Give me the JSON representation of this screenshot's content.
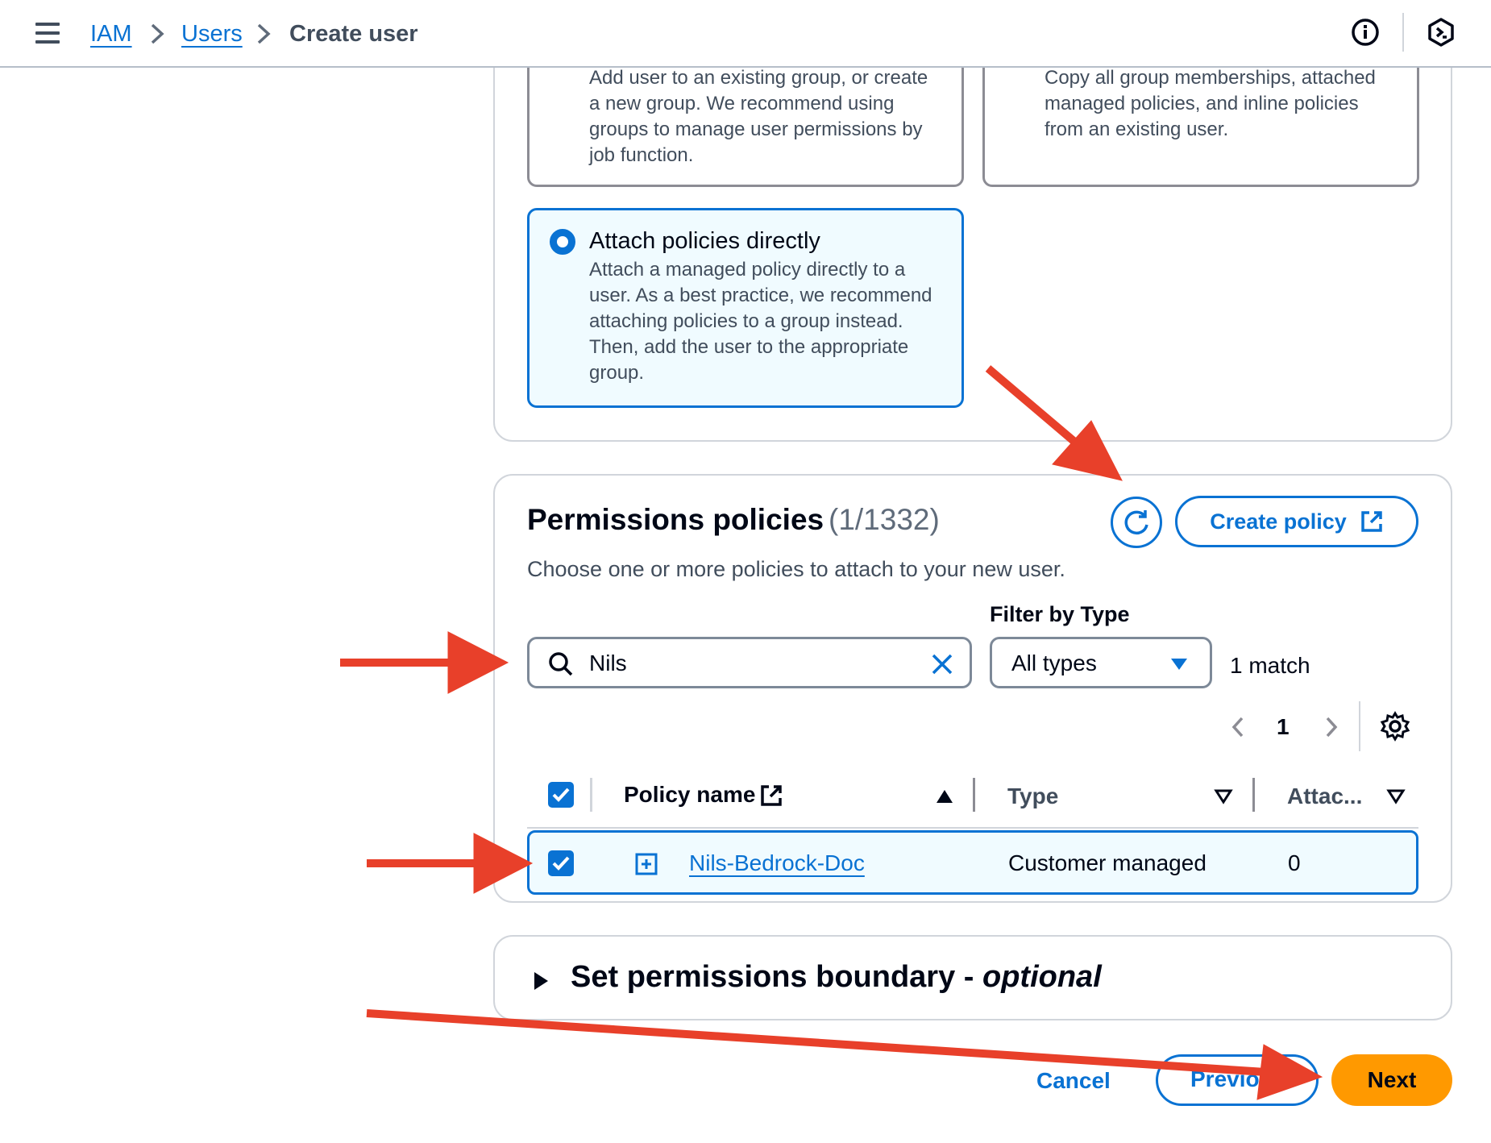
{
  "breadcrumb": {
    "items": [
      "IAM",
      "Users"
    ],
    "current": "Create user"
  },
  "top_icons": [
    "info-icon",
    "cloudshell-icon"
  ],
  "permission_options": {
    "add_to_group": {
      "description_lines": [
        "Add user to an existing group, or create",
        "a new group. We recommend using",
        "groups to manage user permissions by",
        "job function."
      ]
    },
    "copy_permissions": {
      "description_lines": [
        "Copy all group memberships, attached",
        "managed policies, and inline policies",
        "from an existing user."
      ]
    },
    "attach_directly": {
      "title": "Attach policies directly",
      "selected": true,
      "description_lines": [
        "Attach a managed policy directly to a",
        "user. As a best practice, we recommend",
        "attaching policies to a group instead.",
        "Then, add the user to the appropriate",
        "group."
      ]
    }
  },
  "policies": {
    "title": "Permissions policies",
    "count": "(1/1332)",
    "description": "Choose one or more policies to attach to your new user.",
    "refresh_icon": "refresh-icon",
    "create_policy_label": "Create policy",
    "search_value": "Nils",
    "filter_label": "Filter by Type",
    "filter_value": "All types",
    "match_text": "1 match",
    "current_page": "1",
    "columns": [
      {
        "label": "Policy name",
        "sort": "ascending"
      },
      {
        "label": "Type",
        "sort": "none"
      },
      {
        "label": "Attac...",
        "sort": "none"
      }
    ],
    "rows": [
      {
        "name": "Nils-Bedrock-Doc",
        "type": "Customer managed",
        "attached": "0",
        "selected": true
      }
    ]
  },
  "boundary": {
    "title": "Set permissions boundary - ",
    "title_suffix": "optional"
  },
  "footer": {
    "cancel": "Cancel",
    "previous": "Previous",
    "next": "Next"
  },
  "colors": {
    "accent": "#0972d3",
    "primary_button": "#ff9900",
    "annotation_arrow": "#e8402a"
  }
}
